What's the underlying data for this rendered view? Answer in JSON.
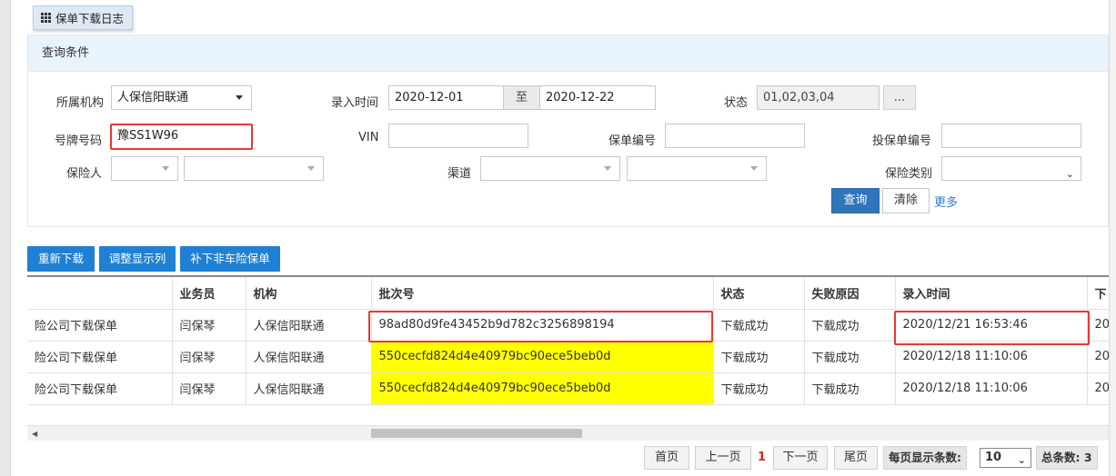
{
  "tab": {
    "title": "保单下载日志"
  },
  "panel": {
    "title": "查询条件"
  },
  "form": {
    "org_label": "所属机构",
    "org_value": "人保信阳联通",
    "entry_time_label": "录入时间",
    "date_from": "2020-12-01",
    "date_sep": "至",
    "date_to": "2020-12-22",
    "status_label": "状态",
    "status_value": "01,02,03,04",
    "status_picker": "...",
    "plate_label": "号牌号码",
    "plate_value": "豫SS1W96",
    "vin_label": "VIN",
    "vin_value": "",
    "policy_no_label": "保单编号",
    "policy_no_value": "",
    "proposal_no_label": "投保单编号",
    "proposal_no_value": "",
    "insurer_label": "保险人",
    "channel_label": "渠道",
    "ins_type_label": "保险类别"
  },
  "buttons": {
    "query": "查询",
    "clear": "清除",
    "more": "更多"
  },
  "actions": {
    "redownload": "重新下载",
    "adjust_columns": "调整显示列",
    "download_non_auto": "补下非车险保单"
  },
  "table": {
    "headers": [
      "",
      "业务员",
      "机构",
      "批次号",
      "状态",
      "失败原因",
      "录入时间",
      "下"
    ],
    "rows": [
      [
        "险公司下载保单",
        "闫保琴",
        "人保信阳联通",
        "98ad80d9fe43452b9d782c3256898194",
        "下载成功",
        "下载成功",
        "2020/12/21 16:53:46",
        "20"
      ],
      [
        "险公司下载保单",
        "闫保琴",
        "人保信阳联通",
        "550cecfd824d4e40979bc90ece5beb0d",
        "下载成功",
        "下载成功",
        "2020/12/18 11:10:06",
        "20"
      ],
      [
        "险公司下载保单",
        "闫保琴",
        "人保信阳联通",
        "550cecfd824d4e40979bc90ece5beb0d",
        "下载成功",
        "下载成功",
        "2020/12/18 11:10:06",
        "20"
      ]
    ]
  },
  "pagination": {
    "first": "首页",
    "prev": "上一页",
    "current": "1",
    "next": "下一页",
    "last": "尾页",
    "per_page_label": "每页显示条数:",
    "per_page_value": "10",
    "total_label": "总条数: 3"
  },
  "colors": {
    "primary": "#1f80d4",
    "query_btn": "#3174b9",
    "highlight": "#ffff00",
    "annotation": "#e53935",
    "header_bg": "#e9f3fc"
  }
}
